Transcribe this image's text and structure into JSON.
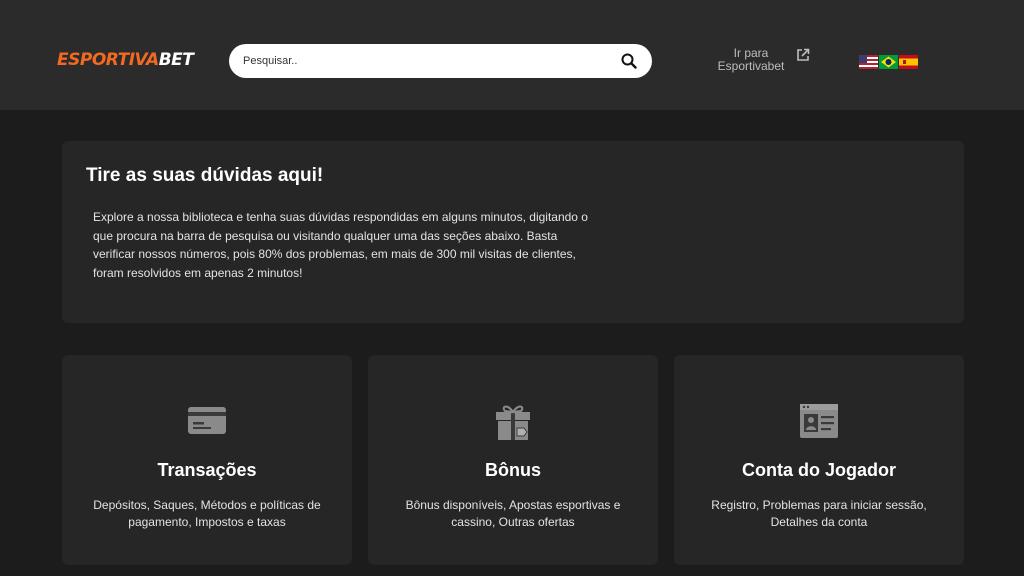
{
  "header": {
    "logo_part1": "ESPORTIVA",
    "logo_part2": "BET",
    "search_placeholder": "Pesquisar..",
    "search_icon": "search-icon",
    "external_link_line1": "Ir para",
    "external_link_line2": "Esportivabet",
    "external_icon": "external-link-icon",
    "flags": [
      "us-flag-icon",
      "brazil-flag-icon",
      "spain-flag-icon"
    ]
  },
  "hero": {
    "title": "Tire as suas dúvidas aqui!",
    "description": "Explore a nossa biblioteca e tenha suas dúvidas respondidas em alguns minutos, digitando o que procura na barra de pesquisa ou visitando qualquer uma das seções abaixo. Basta verificar nossos números, pois 80% dos problemas, em mais de 300 mil visitas de clientes, foram resolvidos em apenas 2 minutos!"
  },
  "cards": [
    {
      "title": "Transações",
      "description": "Depósitos, Saques, Métodos e políticas de pagamento, Impostos e taxas",
      "icon": "credit-card-icon"
    },
    {
      "title": "Bônus",
      "description": "Bônus disponíveis, Apostas esportivas e cassino, Outras ofertas",
      "icon": "gift-icon"
    },
    {
      "title": "Conta do Jogador",
      "description": "Registro, Problemas para iniciar sessão, Detalhes da conta",
      "icon": "account-profile-icon"
    }
  ],
  "colors": {
    "accent": "#f26a21",
    "header_bg": "#2b2b2b",
    "page_bg": "#1c1c1c",
    "card_bg": "#262626",
    "icon_gray": "#8a8a8a"
  }
}
